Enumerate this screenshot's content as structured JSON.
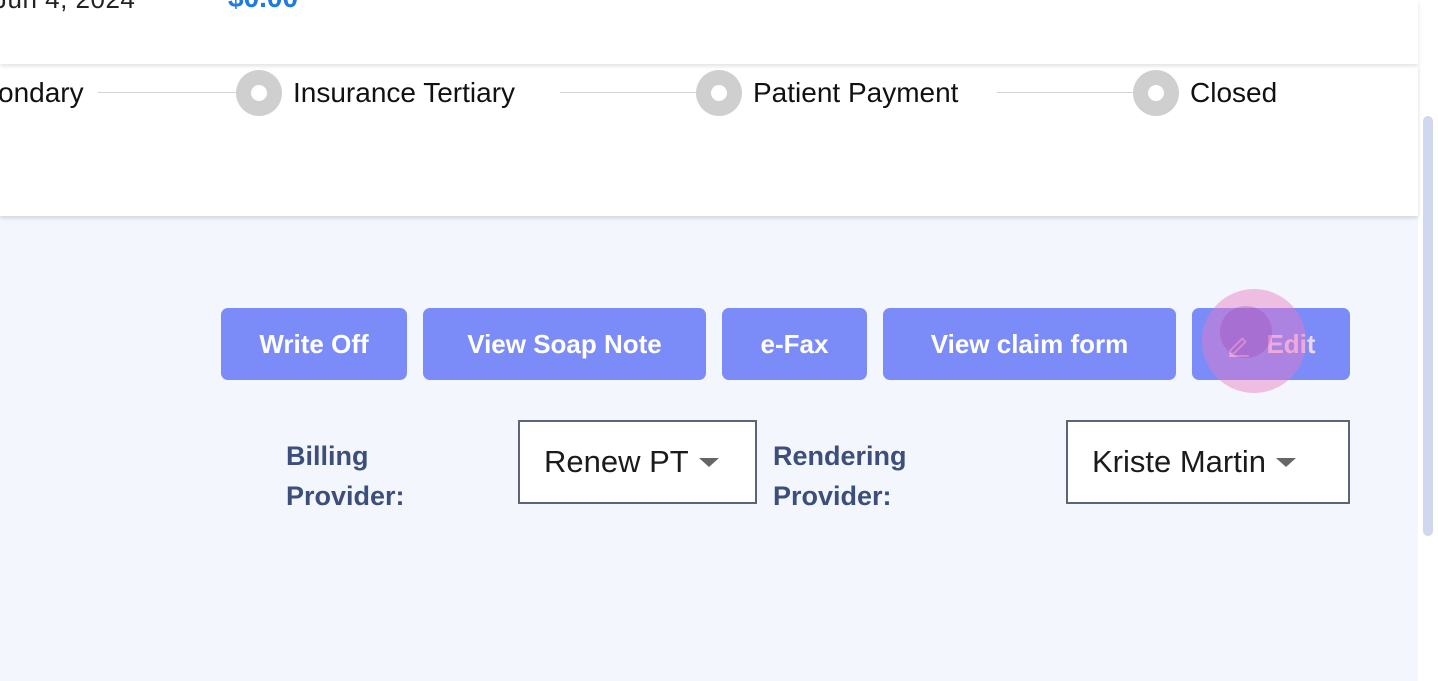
{
  "header": {
    "date_fragment": "Jun 4, 2024",
    "amount_fragment": "$0.00"
  },
  "claim_status": {
    "steps": [
      {
        "label": "ondary"
      },
      {
        "label": "Insurance Tertiary"
      },
      {
        "label": "Patient Payment"
      },
      {
        "label": "Closed"
      }
    ]
  },
  "actions": {
    "write_off": "Write Off",
    "view_soap_note": "View Soap Note",
    "efax": "e-Fax",
    "view_claim_form": "View claim form",
    "edit": "Edit"
  },
  "providers": {
    "billing_label_1": "Billing",
    "billing_label_2": "Provider:",
    "billing_value": "Renew PT",
    "rendering_label_1": "Rendering",
    "rendering_label_2": "Provider:",
    "rendering_value": "Kriste Martin"
  },
  "colors": {
    "button_bg": "#7b8cf9",
    "label_text": "#3c4f7a",
    "page_bg": "#f3f6fc",
    "amount": "#1e7be6"
  }
}
